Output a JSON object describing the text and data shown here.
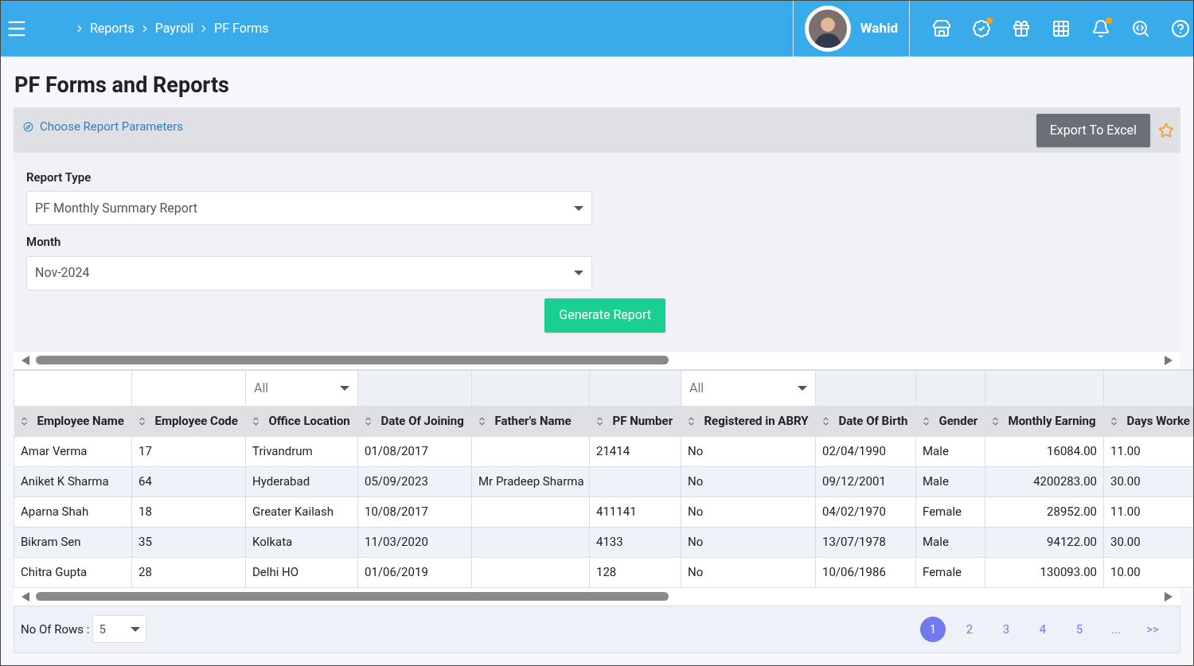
{
  "breadcrumb": [
    "Reports",
    "Payroll",
    "PF Forms"
  ],
  "user": {
    "name": "Wahid"
  },
  "toolbar": [
    {
      "kind": "store",
      "badge": false
    },
    {
      "kind": "verified",
      "badge": true
    },
    {
      "kind": "gift",
      "badge": false
    },
    {
      "kind": "apps",
      "badge": false
    },
    {
      "kind": "bell",
      "badge": true
    },
    {
      "kind": "search",
      "badge": false
    },
    {
      "kind": "help",
      "badge": false
    }
  ],
  "page_title": "PF Forms and Reports",
  "parameters_link": "Choose Report Parameters",
  "export_button": "Export To Excel",
  "favorite": {
    "on": false
  },
  "form": [
    {
      "label": "Report Type",
      "value": "PF Monthly Summary Report"
    },
    {
      "label": "Month",
      "value": "Nov-2024"
    }
  ],
  "generate_button": "Generate Report",
  "table": {
    "columns": [
      {
        "label": "Employee Name",
        "kind": "text"
      },
      {
        "label": "Employee Code",
        "kind": "text"
      },
      {
        "label": "Office Location",
        "kind": "text",
        "filter_value": "All"
      },
      {
        "label": "Date Of Joining",
        "kind": "text"
      },
      {
        "label": "Father's Name",
        "kind": "text"
      },
      {
        "label": "PF Number",
        "kind": "text"
      },
      {
        "label": "Registered in ABRY",
        "kind": "text",
        "filter_value": "All"
      },
      {
        "label": "Date Of Birth",
        "kind": "text"
      },
      {
        "label": "Gender",
        "kind": "text"
      },
      {
        "label": "Monthly Earning",
        "kind": "number"
      },
      {
        "label": "Days Worke",
        "kind": "text"
      }
    ],
    "rows": [
      [
        "Amar Verma",
        "17",
        "Trivandrum",
        "01/08/2017",
        "",
        "21414",
        "No",
        "02/04/1990",
        "Male",
        "16084.00",
        "11.00"
      ],
      [
        "Aniket K Sharma",
        "64",
        "Hyderabad",
        "05/09/2023",
        "Mr Pradeep Sharma",
        "",
        "No",
        "09/12/2001",
        "Male",
        "4200283.00",
        "30.00"
      ],
      [
        "Aparna Shah",
        "18",
        "Greater Kailash",
        "10/08/2017",
        "",
        "411141",
        "No",
        "04/02/1970",
        "Female",
        "28952.00",
        "11.00"
      ],
      [
        "Bikram Sen",
        "35",
        "Kolkata",
        "11/03/2020",
        "",
        "4133",
        "No",
        "13/07/1978",
        "Male",
        "94122.00",
        "30.00"
      ],
      [
        "Chitra Gupta",
        "28",
        "Delhi HO",
        "01/06/2019",
        "",
        "128",
        "No",
        "10/06/1986",
        "Female",
        "130093.00",
        "10.00"
      ]
    ]
  },
  "rows_per_page": {
    "label": "No Of Rows :",
    "value": "5"
  },
  "pagination": [
    {
      "label": "1",
      "selected": true
    },
    {
      "label": "2",
      "selected": false
    },
    {
      "label": "3",
      "selected": false
    },
    {
      "label": "4",
      "selected": false
    },
    {
      "label": "5",
      "selected": false
    },
    {
      "label": "...",
      "selected": false
    },
    {
      "label": ">>",
      "selected": false
    }
  ]
}
